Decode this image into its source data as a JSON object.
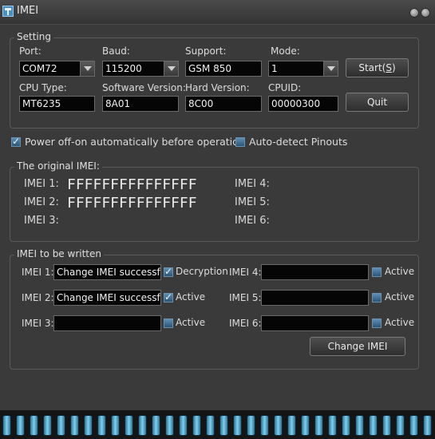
{
  "window": {
    "title": "IMEI",
    "icon": "app-icon"
  },
  "setting": {
    "legend": "Setting",
    "port": {
      "label": "Port:",
      "value": "COM72"
    },
    "baud": {
      "label": "Baud:",
      "value": "115200"
    },
    "support": {
      "label": "Support:",
      "value": "GSM 850"
    },
    "mode": {
      "label": "Mode:",
      "value": "1"
    },
    "cpu_type": {
      "label": "CPU Type:",
      "value": "MT6235"
    },
    "software_version": {
      "label": "Software Version:",
      "value": "8A01"
    },
    "hard_version": {
      "label": "Hard Version:",
      "value": "8C00"
    },
    "cpuid": {
      "label": "CPUID:",
      "value": "00000300"
    },
    "start_label": "Start(S)",
    "start_mnemonic_pre": "Start(",
    "start_mnemonic_key": "S",
    "start_mnemonic_post": ")",
    "quit_label": "Quit"
  },
  "options": {
    "power_off_on": {
      "label": "Power off-on automatically before operation",
      "checked": true
    },
    "auto_detect": {
      "label": "Auto-detect Pinouts",
      "checked": false
    }
  },
  "original": {
    "legend": "The original IMEI:",
    "imei1": {
      "label": "IMEI 1:",
      "value": "FFFFFFFFFFFFFFF"
    },
    "imei2": {
      "label": "IMEI 2:",
      "value": "FFFFFFFFFFFFFFF"
    },
    "imei3": {
      "label": "IMEI 3:",
      "value": ""
    },
    "imei4": {
      "label": "IMEI 4:",
      "value": ""
    },
    "imei5": {
      "label": "IMEI 5:",
      "value": ""
    },
    "imei6": {
      "label": "IMEI 6:",
      "value": ""
    }
  },
  "write": {
    "legend": "IMEI to be written",
    "imei1": {
      "label": "IMEI 1:",
      "value": "Change IMEI successfull",
      "check_label": "Decryption",
      "checked": true
    },
    "imei2": {
      "label": "IMEI 2:",
      "value": "Change IMEI successfull",
      "check_label": "Active",
      "checked": true
    },
    "imei3": {
      "label": "IMEI 3:",
      "value": "",
      "check_label": "Active",
      "checked": false
    },
    "imei4": {
      "label": "IMEI 4:",
      "value": "",
      "check_label": "Active",
      "checked": false
    },
    "imei5": {
      "label": "IMEI 5:",
      "value": "",
      "check_label": "Active",
      "checked": false
    },
    "imei6": {
      "label": "IMEI 6:",
      "value": "",
      "check_label": "Active",
      "checked": false
    },
    "change_button": "Change IMEI"
  },
  "progress": {
    "fraction": 1.0,
    "segment_color": "#6cc3e8"
  }
}
